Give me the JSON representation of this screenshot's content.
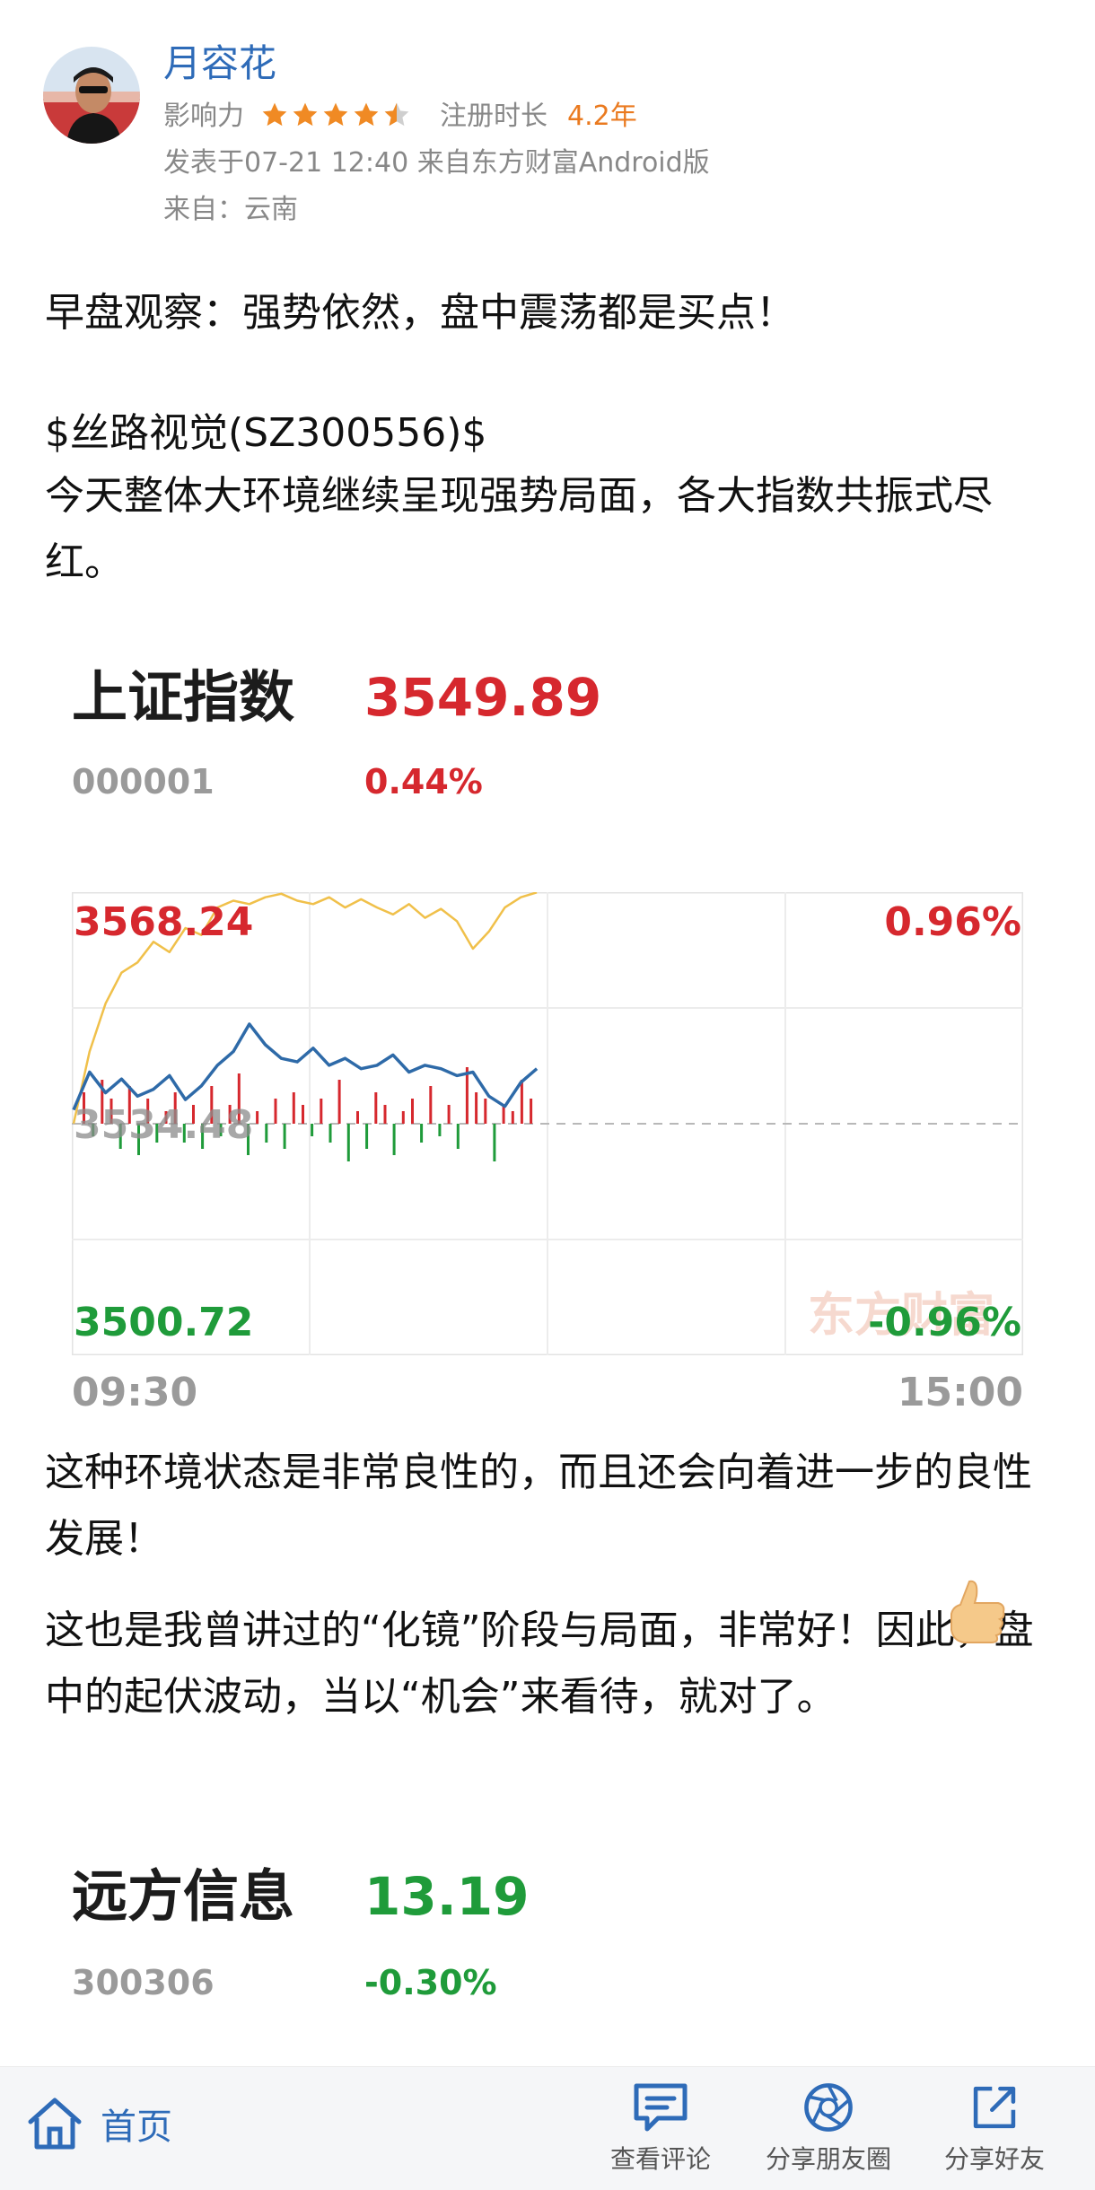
{
  "author": {
    "name": "月容花",
    "influence_label": "影响力",
    "rating_stars": 4.5,
    "registration_label": "注册时长",
    "registration_value": "4.2年",
    "post_meta": "发表于07-21 12:40 来自东方财富Android版",
    "location": "来自：云南"
  },
  "post": {
    "headline": "早盘观察：强势依然，盘中震荡都是买点！",
    "stock_tag": "$丝路视觉(SZ300556)$",
    "paragraph1": "今天整体大环境继续呈现强势局面，各大指数共振式尽红。",
    "paragraph2": "这种环境状态是非常良性的，而且还会向着进一步的良性发展！",
    "paragraph3": "这也是我曾讲过的“化镜”阶段与局面，非常好！因此，盘中的起伏波动，当以“机会”来看待，就对了。"
  },
  "index_card_1": {
    "name": "上证指数",
    "price": "3549.89",
    "code": "000001",
    "change_pct": "0.44%",
    "color": "#d6282e"
  },
  "chart_data": {
    "type": "line",
    "time_start": "09:30",
    "time_end": "15:00",
    "high_label": "3568.24",
    "mid_label": "3534.48",
    "low_label": "3500.72",
    "high_pct_label": "0.96%",
    "low_pct_label": "-0.96%",
    "ylim": [
      3500.72,
      3568.24
    ],
    "watermark": "东方财富",
    "series": [
      {
        "color": "#f0c04a",
        "values": [
          3534.5,
          3545.0,
          3552.0,
          3556.5,
          3558.0,
          3561.0,
          3559.5,
          3563.0,
          3562.0,
          3566.0,
          3567.0,
          3566.5,
          3567.5,
          3568.0,
          3567.0,
          3566.5,
          3567.5,
          3566.0,
          3567.2,
          3566.0,
          3565.0,
          3566.5,
          3564.5,
          3565.8,
          3564.0,
          3560.0,
          3562.5,
          3566.0,
          3567.5,
          3568.2
        ]
      },
      {
        "color": "#2e6aa8",
        "values": [
          3536.5,
          3542.0,
          3539.0,
          3541.0,
          3538.5,
          3539.5,
          3541.5,
          3538.0,
          3540.0,
          3543.0,
          3545.0,
          3549.0,
          3546.0,
          3544.0,
          3543.5,
          3545.5,
          3543.0,
          3544.0,
          3542.5,
          3543.0,
          3544.5,
          3542.0,
          3543.0,
          3542.5,
          3541.5,
          3542.0,
          3538.5,
          3537.0,
          3540.5,
          3542.5
        ]
      }
    ],
    "volume": [
      5,
      -2,
      7,
      4,
      -4,
      6,
      -5,
      4,
      -3,
      2,
      5,
      -3,
      3,
      -4,
      6,
      -2,
      3,
      8,
      -5,
      2,
      -3,
      4,
      -4,
      5,
      3,
      -2,
      4,
      -3,
      7,
      -6,
      2,
      -4,
      5,
      3,
      -5,
      2,
      4,
      -3,
      6,
      -2,
      3,
      -4,
      9,
      5,
      4,
      -6,
      3,
      2,
      7,
      4
    ]
  },
  "post_icons": {
    "thumb": "thumbs-up-icon"
  },
  "index_card_2": {
    "name": "远方信息",
    "price": "13.19",
    "code": "300306",
    "change_pct": "-0.30%",
    "color": "#1f9b3a"
  },
  "bottom_bar": {
    "home_label": "首页",
    "comments_label": "查看评论",
    "moments_label": "分享朋友圈",
    "friends_label": "分享好友"
  }
}
